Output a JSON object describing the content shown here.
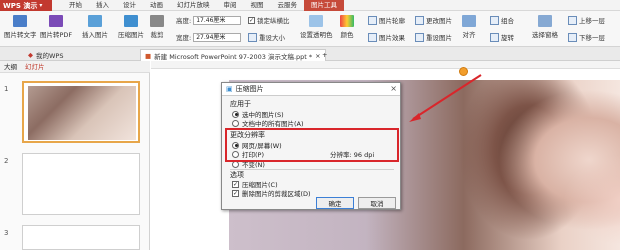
{
  "app": {
    "name": "WPS 演示"
  },
  "menu": {
    "tabs": [
      "开始",
      "插入",
      "设计",
      "动画",
      "幻灯片放映",
      "审阅",
      "视图",
      "云服务",
      "图片工具"
    ]
  },
  "ribbon": {
    "pic_to_text": "图片转文字",
    "pic_to_pdf": "图片转PDF",
    "insert_picture": "插入图片",
    "compress_picture": "压缩图片",
    "crop": "裁剪",
    "height_label": "高度:",
    "height_value": "17.46厘米",
    "width_label": "宽度:",
    "width_value": "27.94厘米",
    "lock_ratio": "锁定纵横比",
    "reset_size": "重设大小",
    "set_transparent": "设置透明色",
    "color": "颜色",
    "picture_outline": "图片轮廓",
    "picture_effects": "图片效果",
    "change_picture": "更改图片",
    "reset_picture": "重设图片",
    "combine": "组合",
    "rotate": "旋转",
    "select_pane": "选择窗格",
    "align": "对齐",
    "bring_forward": "上移一层",
    "send_backward": "下移一层"
  },
  "doc_tabs": {
    "home": "我的WPS",
    "doc": "新建 Microsoft PowerPoint 97-2003 演示文稿.ppt *"
  },
  "left_pane": {
    "tab_outline": "大纲",
    "tab_slides": "幻灯片",
    "slide_numbers": [
      "1",
      "2",
      "3"
    ]
  },
  "dialog": {
    "title": "压缩图片",
    "apply_to_label": "应用于",
    "apply_selected": "选中的图片(S)",
    "apply_all": "文档中的所有图片(A)",
    "resolution_label": "更改分辨率",
    "web_screen": "网页/屏幕(W)",
    "print": "打印(P)",
    "resolution_value": "分辨率: 96 dpi",
    "no_change": "不变(N)",
    "options_label": "选项",
    "compress_pictures": "压缩图片(C)",
    "delete_cropped": "删除图片的剪裁区域(D)",
    "ok": "确定",
    "cancel": "取消"
  },
  "colors": {
    "accent": "#c2392f",
    "highlight": "#d9262b",
    "rotate_handle": "#f29e2c"
  }
}
